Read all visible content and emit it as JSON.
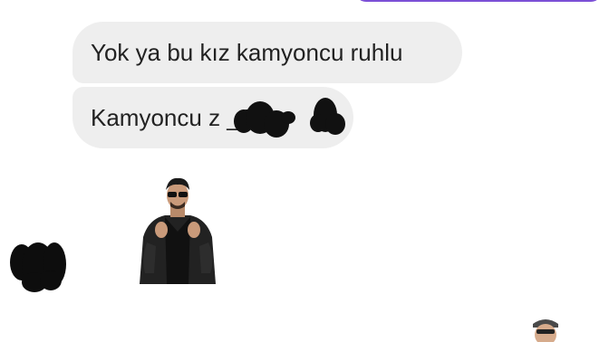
{
  "messages": [
    {
      "text": "Yok ya bu kız kamyoncu ruhlu",
      "direction": "received"
    },
    {
      "text": "Kamyoncu z   _1",
      "direction": "received",
      "redacted": true
    }
  ],
  "stickers": [
    {
      "name": "man-sunglasses-leather-jacket-sticker"
    },
    {
      "name": "partial-sticker-bottom-right"
    }
  ],
  "colors": {
    "received_bubble": "#eeeeee",
    "sent_bubble": "#7b4fd6",
    "text": "#222222",
    "redaction": "#111111"
  }
}
